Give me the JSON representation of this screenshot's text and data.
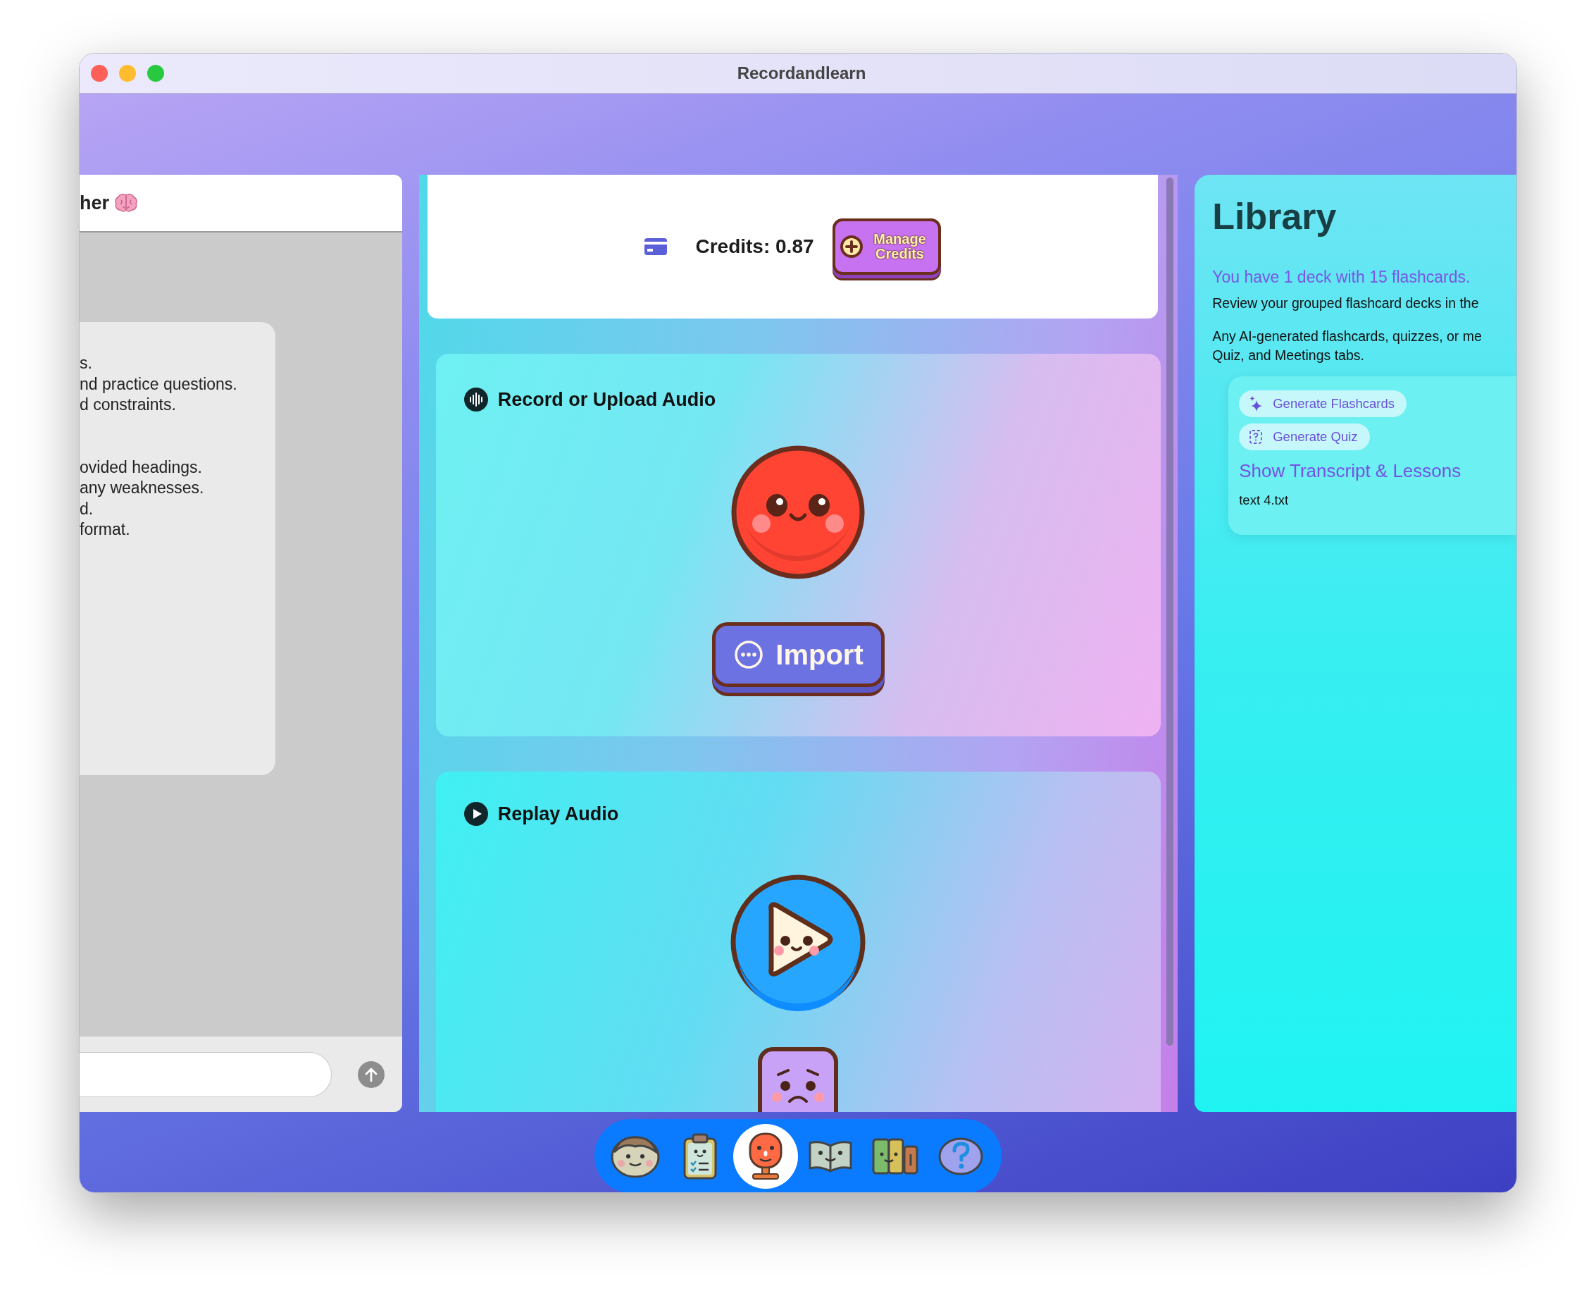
{
  "window": {
    "title": "Recordandlearn"
  },
  "chat_panel": {
    "title": "her",
    "message_paragraphs": [
      {
        "lines": [
          "s.",
          "nd practice questions.",
          "d constraints."
        ]
      },
      {
        "lines": [
          "ovided headings.",
          "any weaknesses.",
          "d.",
          "format."
        ]
      }
    ]
  },
  "credits": {
    "label": "Credits: 0.87",
    "button": "Manage Credits"
  },
  "record_card": {
    "title": "Record or Upload Audio",
    "import_button": "Import"
  },
  "replay_card": {
    "title": "Replay Audio"
  },
  "library": {
    "title": "Library",
    "summary": "You have 1 deck with 15 flashcards.",
    "paragraphs": [
      {
        "lines": [
          "Review your grouped flashcard decks in the"
        ]
      },
      {
        "lines": [
          "Any AI-generated flashcards, quizzes, or me",
          "Quiz, and Meetings tabs."
        ]
      }
    ],
    "item": {
      "actions": [
        {
          "kind": "flashcards",
          "label": "Generate Flashcards"
        },
        {
          "kind": "quiz",
          "label": "Generate Quiz"
        }
      ],
      "link": "Show Transcript & Lessons",
      "file": "text 4.txt"
    }
  },
  "dock": [
    {
      "kind": "profile",
      "selected": false
    },
    {
      "kind": "checklist",
      "selected": false
    },
    {
      "kind": "microphone",
      "selected": true
    },
    {
      "kind": "book",
      "selected": false
    },
    {
      "kind": "books",
      "selected": false
    },
    {
      "kind": "help",
      "selected": false
    }
  ]
}
